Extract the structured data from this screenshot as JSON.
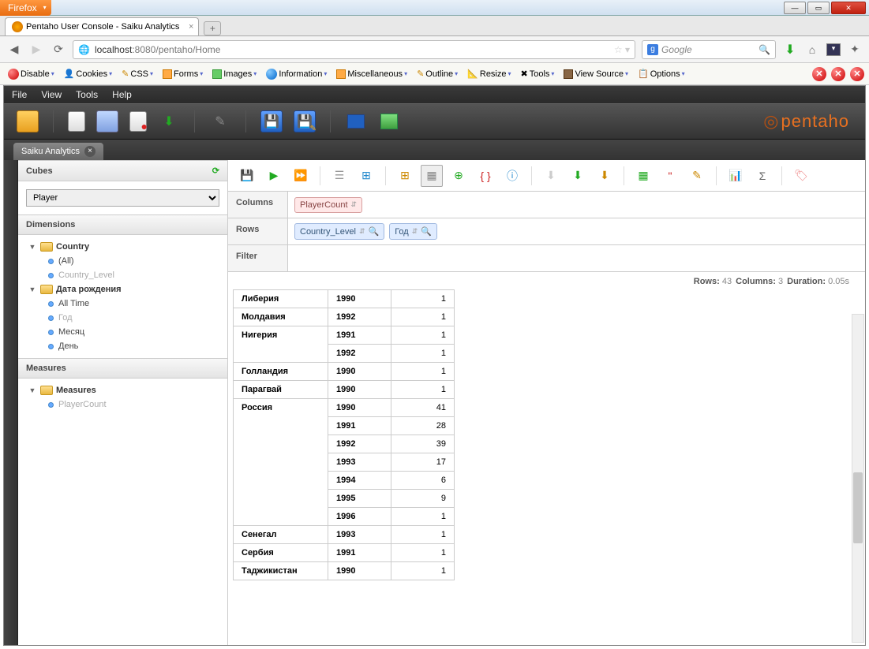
{
  "window": {
    "firefox": "Firefox"
  },
  "browser_tab": {
    "title": "Pentaho User Console - Saiku Analytics"
  },
  "url": {
    "prefix": "localhost",
    "rest": ":8080/pentaho/Home"
  },
  "search": {
    "engine_letter": "g",
    "placeholder": "Google"
  },
  "dev_toolbar": {
    "items": [
      "Disable",
      "Cookies",
      "CSS",
      "Forms",
      "Images",
      "Information",
      "Miscellaneous",
      "Outline",
      "Resize",
      "Tools",
      "View Source",
      "Options"
    ]
  },
  "app_menu": [
    "File",
    "View",
    "Tools",
    "Help"
  ],
  "app_tab": "Saiku Analytics",
  "logo": "pentaho",
  "sidebar": {
    "cubes_hdr": "Cubes",
    "cube_selected": "Player",
    "dimensions_hdr": "Dimensions",
    "dim1": {
      "name": "Country",
      "all": "(All)",
      "level": "Country_Level"
    },
    "dim2": {
      "name": "Дата рождения",
      "all": "All Time",
      "l1": "Год",
      "l2": "Месяц",
      "l3": "День"
    },
    "measures_hdr": "Measures",
    "measures_folder": "Measures",
    "measure1": "PlayerCount"
  },
  "zones": {
    "columns_label": "Columns",
    "rows_label": "Rows",
    "filter_label": "Filter",
    "col_chip": "PlayerCount",
    "row_chip1": "Country_Level",
    "row_chip2": "Год"
  },
  "status": {
    "rows_lbl": "Rows:",
    "rows_val": "43",
    "cols_lbl": "Columns:",
    "cols_val": "3",
    "dur_lbl": "Duration:",
    "dur_val": "0.05s"
  },
  "table": [
    {
      "country": "Либерия",
      "rows": [
        {
          "year": "1990",
          "val": "1"
        }
      ]
    },
    {
      "country": "Молдавия",
      "rows": [
        {
          "year": "1992",
          "val": "1"
        }
      ]
    },
    {
      "country": "Нигерия",
      "rows": [
        {
          "year": "1991",
          "val": "1"
        },
        {
          "year": "1992",
          "val": "1"
        }
      ]
    },
    {
      "country": "Голландия",
      "rows": [
        {
          "year": "1990",
          "val": "1"
        }
      ]
    },
    {
      "country": "Парагвай",
      "rows": [
        {
          "year": "1990",
          "val": "1"
        }
      ]
    },
    {
      "country": "Россия",
      "rows": [
        {
          "year": "1990",
          "val": "41"
        },
        {
          "year": "1991",
          "val": "28"
        },
        {
          "year": "1992",
          "val": "39"
        },
        {
          "year": "1993",
          "val": "17"
        },
        {
          "year": "1994",
          "val": "6"
        },
        {
          "year": "1995",
          "val": "9"
        },
        {
          "year": "1996",
          "val": "1"
        }
      ]
    },
    {
      "country": "Сенегал",
      "rows": [
        {
          "year": "1993",
          "val": "1"
        }
      ]
    },
    {
      "country": "Сербия",
      "rows": [
        {
          "year": "1991",
          "val": "1"
        }
      ]
    },
    {
      "country": "Таджикистан",
      "rows": [
        {
          "year": "1990",
          "val": "1"
        }
      ]
    }
  ]
}
